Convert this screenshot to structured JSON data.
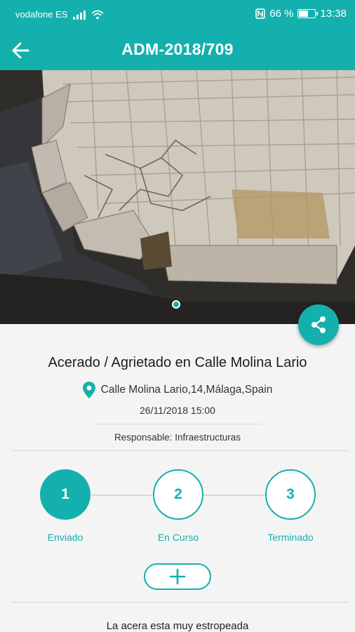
{
  "status_bar": {
    "carrier": "vodafone ES",
    "battery_percent": "66 %",
    "battery_level": 0.66,
    "time": "13:38",
    "icons": [
      "signal-icon",
      "wifi-icon",
      "nfc-icon",
      "battery-icon"
    ]
  },
  "app_bar": {
    "title": "ADM-2018/709",
    "back_icon": "arrow-left-icon"
  },
  "photo": {
    "pager_pages": 1,
    "pager_active": 1,
    "share_icon": "share-icon"
  },
  "incident": {
    "title": "Acerado / Agrietado en Calle Molina Lario",
    "address": "Calle Molina Lario,14,Málaga,Spain",
    "location_icon": "location-pin-icon",
    "date": "26/11/2018 15:00",
    "responsible": "Responsable: Infraestructuras"
  },
  "progress": {
    "steps": [
      {
        "number": "1",
        "label": "Enviado",
        "state": "done"
      },
      {
        "number": "2",
        "label": "En Curso",
        "state": "pending"
      },
      {
        "number": "3",
        "label": "Terminado",
        "state": "pending"
      }
    ]
  },
  "actions": {
    "add_icon": "plus-icon"
  },
  "comment": {
    "text": "La acera esta muy estropeada"
  },
  "colors": {
    "primary": "#14b0ad",
    "background": "#f4f4f4"
  }
}
